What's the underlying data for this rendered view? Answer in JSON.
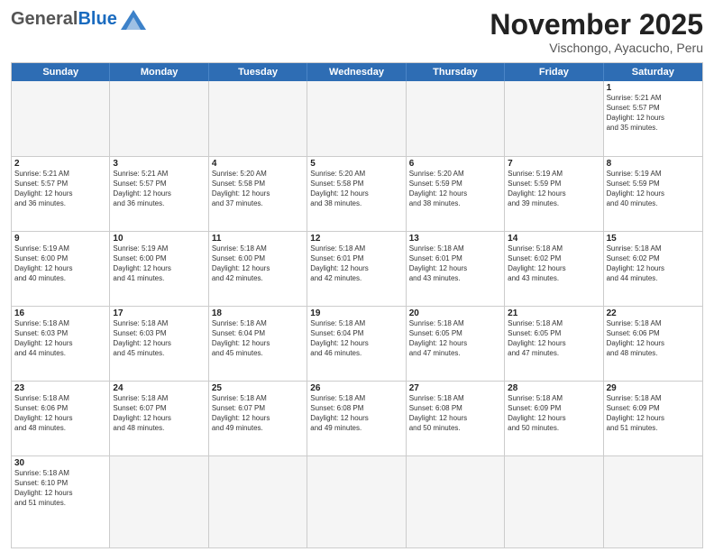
{
  "header": {
    "logo": {
      "general": "General",
      "blue": "Blue"
    },
    "title": "November 2025",
    "subtitle": "Vischongo, Ayacucho, Peru"
  },
  "days": [
    "Sunday",
    "Monday",
    "Tuesday",
    "Wednesday",
    "Thursday",
    "Friday",
    "Saturday"
  ],
  "weeks": [
    [
      {
        "day": "",
        "info": ""
      },
      {
        "day": "",
        "info": ""
      },
      {
        "day": "",
        "info": ""
      },
      {
        "day": "",
        "info": ""
      },
      {
        "day": "",
        "info": ""
      },
      {
        "day": "",
        "info": ""
      },
      {
        "day": "1",
        "info": "Sunrise: 5:21 AM\nSunset: 5:57 PM\nDaylight: 12 hours\nand 35 minutes."
      }
    ],
    [
      {
        "day": "2",
        "info": "Sunrise: 5:21 AM\nSunset: 5:57 PM\nDaylight: 12 hours\nand 36 minutes."
      },
      {
        "day": "3",
        "info": "Sunrise: 5:21 AM\nSunset: 5:57 PM\nDaylight: 12 hours\nand 36 minutes."
      },
      {
        "day": "4",
        "info": "Sunrise: 5:20 AM\nSunset: 5:58 PM\nDaylight: 12 hours\nand 37 minutes."
      },
      {
        "day": "5",
        "info": "Sunrise: 5:20 AM\nSunset: 5:58 PM\nDaylight: 12 hours\nand 38 minutes."
      },
      {
        "day": "6",
        "info": "Sunrise: 5:20 AM\nSunset: 5:59 PM\nDaylight: 12 hours\nand 38 minutes."
      },
      {
        "day": "7",
        "info": "Sunrise: 5:19 AM\nSunset: 5:59 PM\nDaylight: 12 hours\nand 39 minutes."
      },
      {
        "day": "8",
        "info": "Sunrise: 5:19 AM\nSunset: 5:59 PM\nDaylight: 12 hours\nand 40 minutes."
      }
    ],
    [
      {
        "day": "9",
        "info": "Sunrise: 5:19 AM\nSunset: 6:00 PM\nDaylight: 12 hours\nand 40 minutes."
      },
      {
        "day": "10",
        "info": "Sunrise: 5:19 AM\nSunset: 6:00 PM\nDaylight: 12 hours\nand 41 minutes."
      },
      {
        "day": "11",
        "info": "Sunrise: 5:18 AM\nSunset: 6:00 PM\nDaylight: 12 hours\nand 42 minutes."
      },
      {
        "day": "12",
        "info": "Sunrise: 5:18 AM\nSunset: 6:01 PM\nDaylight: 12 hours\nand 42 minutes."
      },
      {
        "day": "13",
        "info": "Sunrise: 5:18 AM\nSunset: 6:01 PM\nDaylight: 12 hours\nand 43 minutes."
      },
      {
        "day": "14",
        "info": "Sunrise: 5:18 AM\nSunset: 6:02 PM\nDaylight: 12 hours\nand 43 minutes."
      },
      {
        "day": "15",
        "info": "Sunrise: 5:18 AM\nSunset: 6:02 PM\nDaylight: 12 hours\nand 44 minutes."
      }
    ],
    [
      {
        "day": "16",
        "info": "Sunrise: 5:18 AM\nSunset: 6:03 PM\nDaylight: 12 hours\nand 44 minutes."
      },
      {
        "day": "17",
        "info": "Sunrise: 5:18 AM\nSunset: 6:03 PM\nDaylight: 12 hours\nand 45 minutes."
      },
      {
        "day": "18",
        "info": "Sunrise: 5:18 AM\nSunset: 6:04 PM\nDaylight: 12 hours\nand 45 minutes."
      },
      {
        "day": "19",
        "info": "Sunrise: 5:18 AM\nSunset: 6:04 PM\nDaylight: 12 hours\nand 46 minutes."
      },
      {
        "day": "20",
        "info": "Sunrise: 5:18 AM\nSunset: 6:05 PM\nDaylight: 12 hours\nand 47 minutes."
      },
      {
        "day": "21",
        "info": "Sunrise: 5:18 AM\nSunset: 6:05 PM\nDaylight: 12 hours\nand 47 minutes."
      },
      {
        "day": "22",
        "info": "Sunrise: 5:18 AM\nSunset: 6:06 PM\nDaylight: 12 hours\nand 48 minutes."
      }
    ],
    [
      {
        "day": "23",
        "info": "Sunrise: 5:18 AM\nSunset: 6:06 PM\nDaylight: 12 hours\nand 48 minutes."
      },
      {
        "day": "24",
        "info": "Sunrise: 5:18 AM\nSunset: 6:07 PM\nDaylight: 12 hours\nand 48 minutes."
      },
      {
        "day": "25",
        "info": "Sunrise: 5:18 AM\nSunset: 6:07 PM\nDaylight: 12 hours\nand 49 minutes."
      },
      {
        "day": "26",
        "info": "Sunrise: 5:18 AM\nSunset: 6:08 PM\nDaylight: 12 hours\nand 49 minutes."
      },
      {
        "day": "27",
        "info": "Sunrise: 5:18 AM\nSunset: 6:08 PM\nDaylight: 12 hours\nand 50 minutes."
      },
      {
        "day": "28",
        "info": "Sunrise: 5:18 AM\nSunset: 6:09 PM\nDaylight: 12 hours\nand 50 minutes."
      },
      {
        "day": "29",
        "info": "Sunrise: 5:18 AM\nSunset: 6:09 PM\nDaylight: 12 hours\nand 51 minutes."
      }
    ],
    [
      {
        "day": "30",
        "info": "Sunrise: 5:18 AM\nSunset: 6:10 PM\nDaylight: 12 hours\nand 51 minutes."
      },
      {
        "day": "",
        "info": ""
      },
      {
        "day": "",
        "info": ""
      },
      {
        "day": "",
        "info": ""
      },
      {
        "day": "",
        "info": ""
      },
      {
        "day": "",
        "info": ""
      },
      {
        "day": "",
        "info": ""
      }
    ]
  ]
}
